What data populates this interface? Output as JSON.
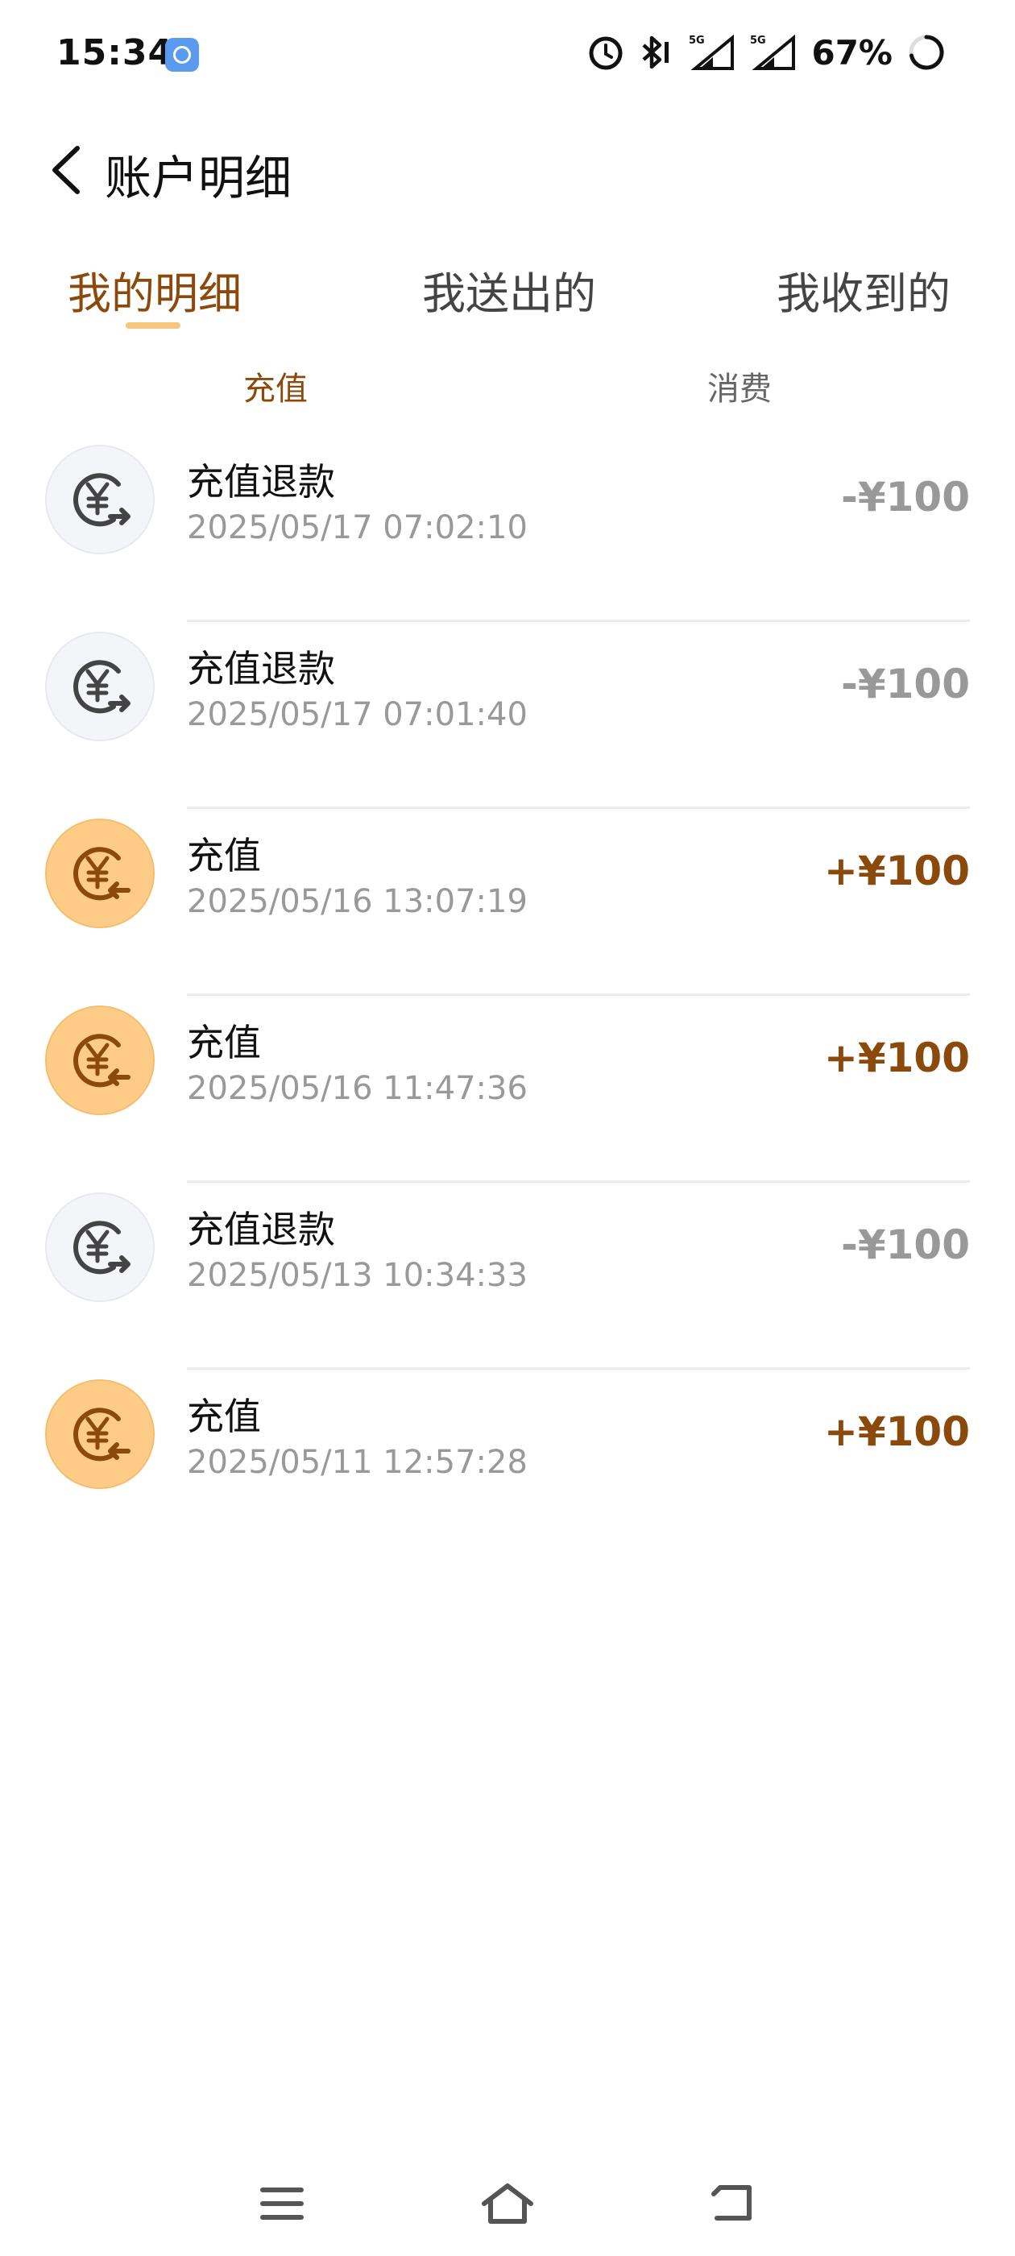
{
  "status_bar": {
    "time": "15:34",
    "battery_percent": "67%",
    "network_label_1": "5G",
    "network_label_2": "5G"
  },
  "header": {
    "title": "账户明细"
  },
  "tabs": [
    {
      "label": "我的明细",
      "active": true
    },
    {
      "label": "我送出的",
      "active": false
    },
    {
      "label": "我收到的",
      "active": false
    }
  ],
  "subtabs": [
    {
      "label": "充值",
      "active": true
    },
    {
      "label": "消费",
      "active": false
    }
  ],
  "transactions": [
    {
      "title": "充值退款",
      "time": "2025/05/17 07:02:10",
      "amount": "-¥100",
      "type": "refund"
    },
    {
      "title": "充值退款",
      "time": "2025/05/17 07:01:40",
      "amount": "-¥100",
      "type": "refund"
    },
    {
      "title": "充值",
      "time": "2025/05/16 13:07:19",
      "amount": "+¥100",
      "type": "charge"
    },
    {
      "title": "充值",
      "time": "2025/05/16 11:47:36",
      "amount": "+¥100",
      "type": "charge"
    },
    {
      "title": "充值退款",
      "time": "2025/05/13 10:34:33",
      "amount": "-¥100",
      "type": "refund"
    },
    {
      "title": "充值",
      "time": "2025/05/11 12:57:28",
      "amount": "+¥100",
      "type": "charge"
    }
  ],
  "colors": {
    "accent": "#8b4a0c",
    "tab_underline": "#f5c77a",
    "charge_icon_bg": "#ffcc88",
    "refund_icon_bg": "#f4f5f9",
    "negative_amount": "#999999"
  },
  "icons": {
    "status_app": "app-icon",
    "alarm": "alarm-icon",
    "bluetooth": "bluetooth-icon",
    "signal": "signal-icon",
    "battery": "battery-ring-icon",
    "back": "chevron-left-icon",
    "refund": "yuan-refund-icon",
    "charge": "yuan-charge-icon",
    "nav_menu": "menu-icon",
    "nav_home": "home-icon",
    "nav_back": "back-arrow-icon"
  }
}
